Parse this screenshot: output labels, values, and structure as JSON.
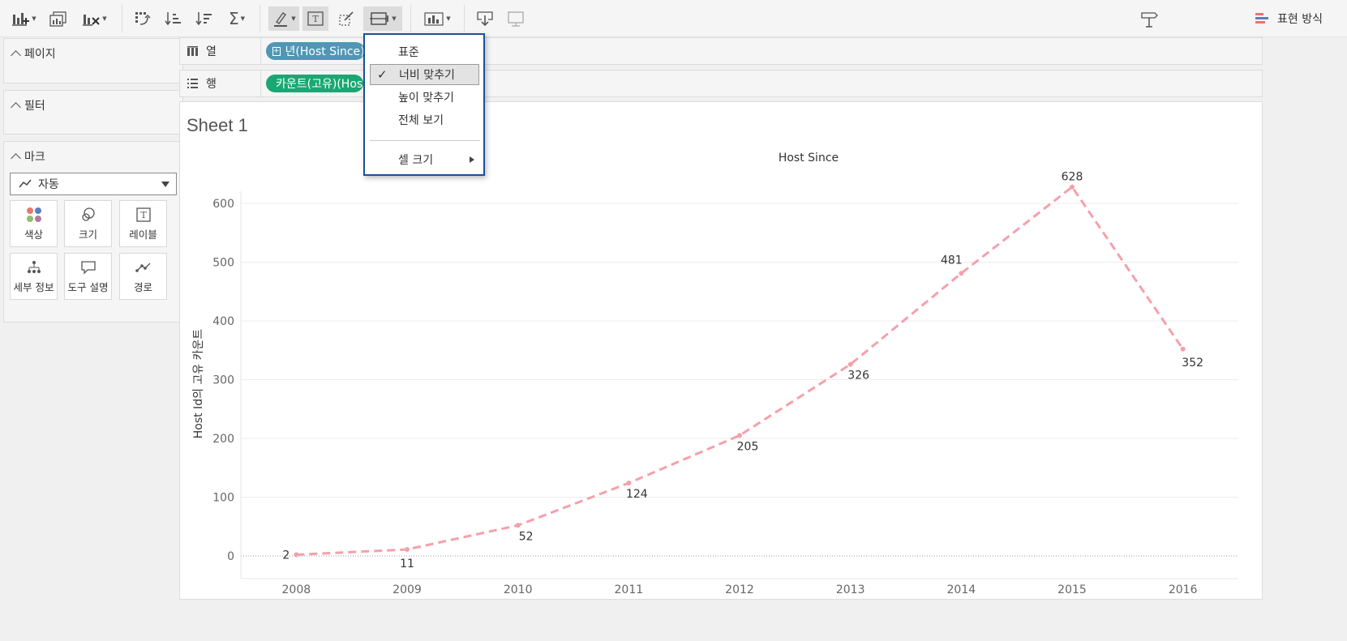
{
  "toolbar": {
    "show_me_label": "표현 방식"
  },
  "left_panel": {
    "pages_label": "페이지",
    "filters_label": "필터",
    "marks_label": "마크",
    "mark_type": "자동",
    "mark_cards": [
      {
        "label": "색상",
        "icon": "color-icon"
      },
      {
        "label": "크기",
        "icon": "size-icon"
      },
      {
        "label": "레이블",
        "icon": "label-icon"
      },
      {
        "label": "세부 정보",
        "icon": "detail-icon"
      },
      {
        "label": "도구 설명",
        "icon": "tooltip-icon"
      },
      {
        "label": "경로",
        "icon": "path-icon"
      }
    ]
  },
  "shelves": {
    "columns_label": "열",
    "columns_pill": "년(Host Since)",
    "rows_label": "행",
    "rows_pill": "카운트(고유)(Host Id)"
  },
  "fit_menu": {
    "items": [
      "표준",
      "너비 맞추기",
      "높이 맞추기",
      "전체 보기"
    ],
    "selected": "너비 맞추기",
    "cell_size": "셀 크기"
  },
  "sheet": {
    "title": "Sheet 1"
  },
  "chart_data": {
    "type": "line",
    "title": "Host Since",
    "xlabel": "",
    "ylabel": "Host Id의 고유 카운트",
    "categories": [
      "2008",
      "2009",
      "2010",
      "2011",
      "2012",
      "2013",
      "2014",
      "2015",
      "2016"
    ],
    "values": [
      2,
      11,
      52,
      124,
      205,
      326,
      481,
      628,
      352
    ],
    "ylim": [
      0,
      600
    ],
    "yticks": [
      0,
      100,
      200,
      300,
      400,
      500,
      600
    ],
    "line_style": "dashed",
    "color": "#f5a0aa",
    "grid": true
  },
  "colors": {
    "pill_dimension": "#4f97b5",
    "pill_measure": "#1ba774",
    "line": "#f5a0aa",
    "menu_border": "#1c4f9c"
  }
}
